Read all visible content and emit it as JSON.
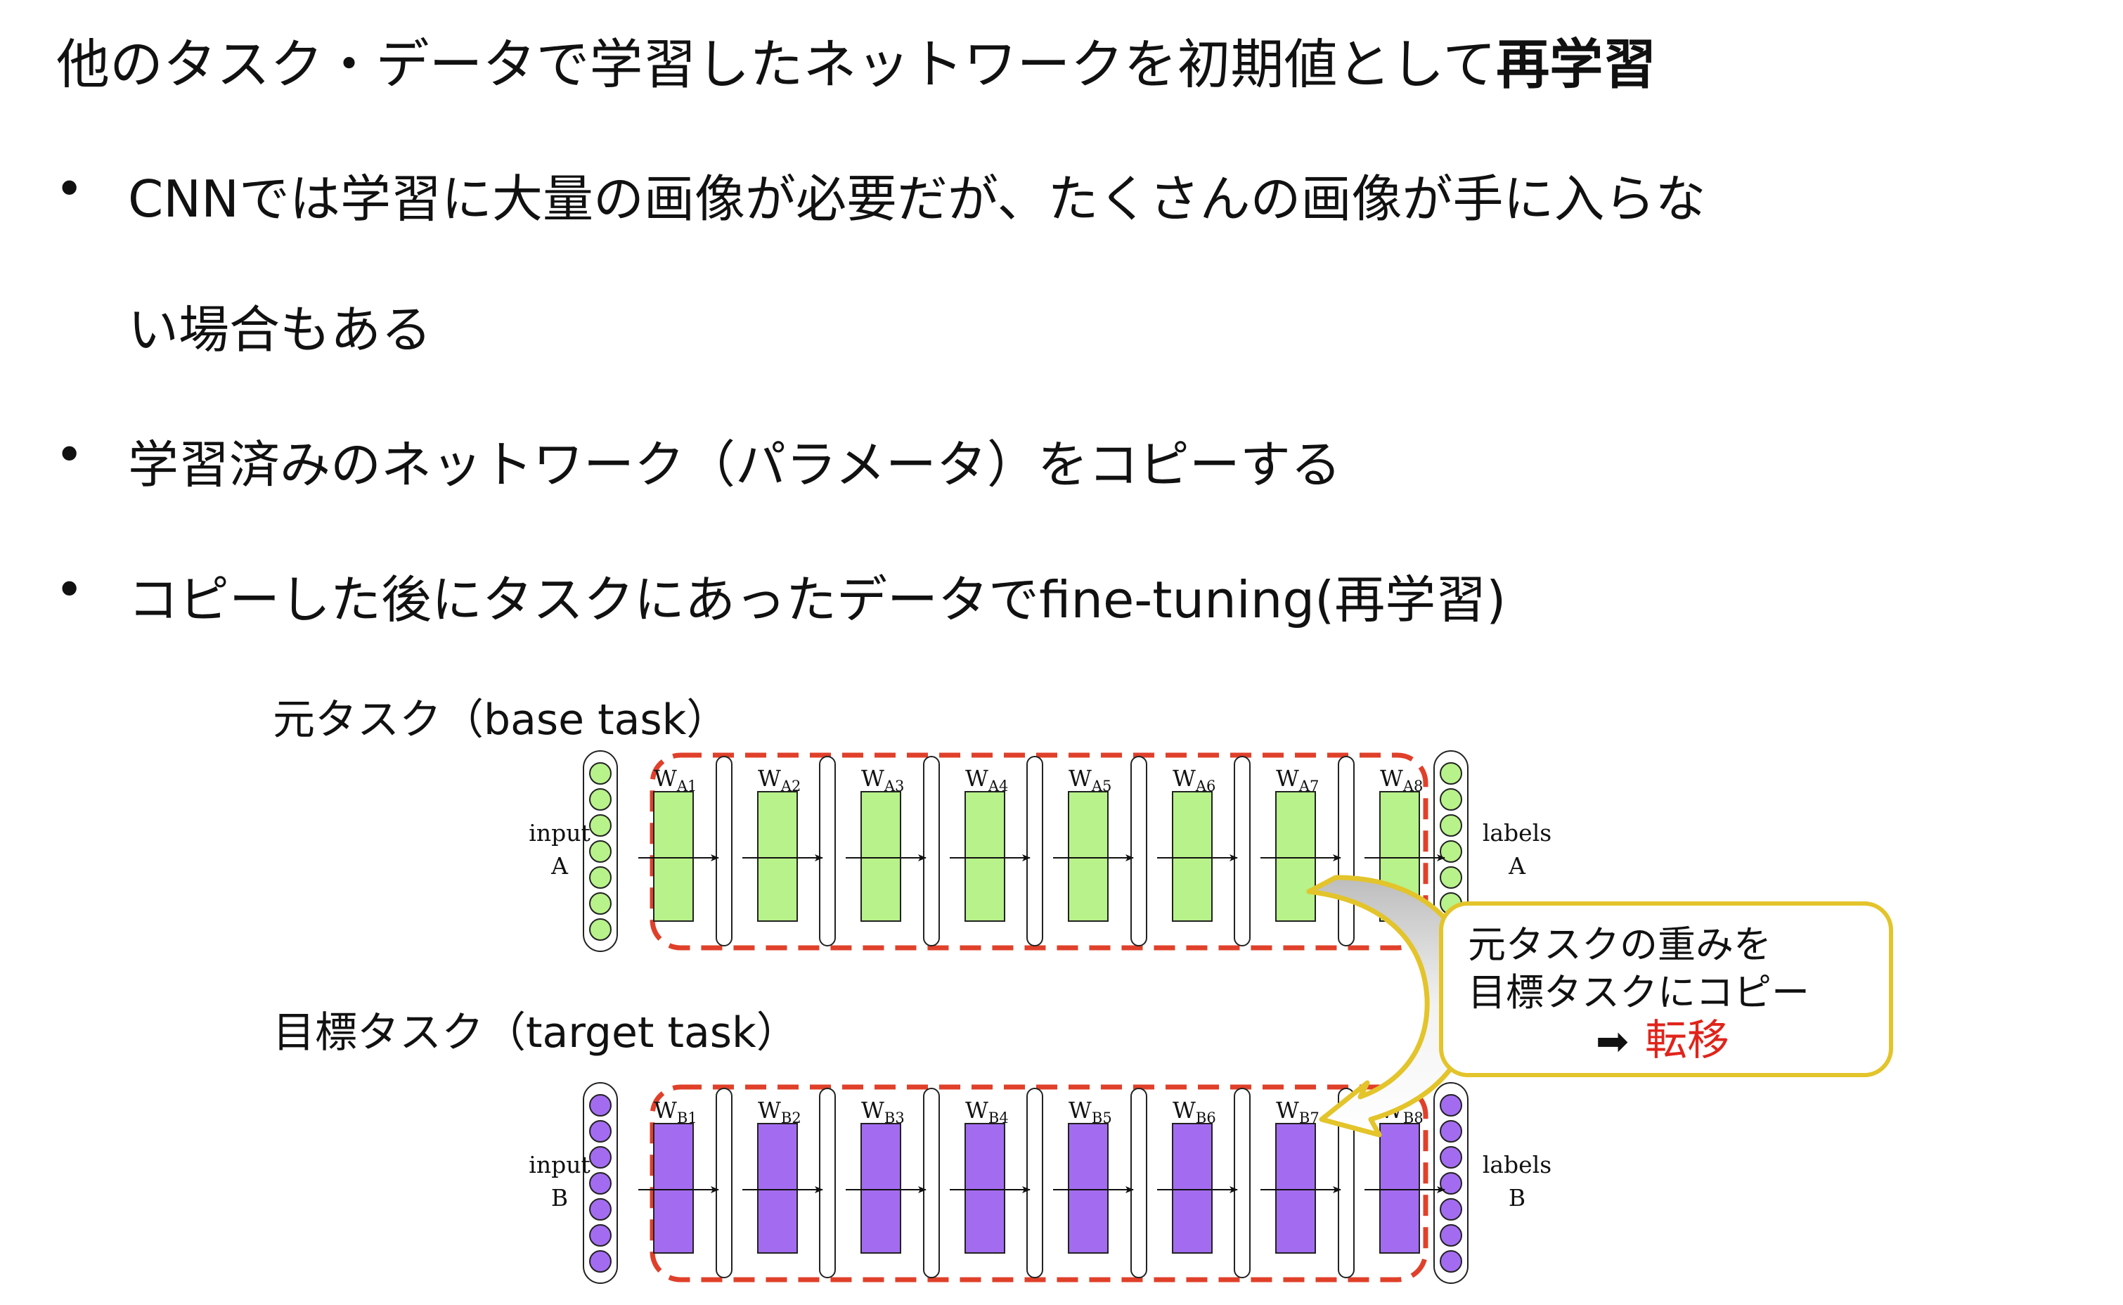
{
  "headline": {
    "text": "他のタスク・データで学習したネットワークを初期値として",
    "bold": "再学習"
  },
  "bullets": [
    {
      "lines": [
        "CNNでは学習に大量の画像が必要だが、たくさんの画像が手に入らな",
        "い場合もある"
      ]
    },
    {
      "lines": [
        "学習済みのネットワーク（パラメータ）をコピーする"
      ]
    },
    {
      "lines": [
        "コピーした後にタスクにあったデータでfine-tuning(再学習)"
      ]
    }
  ],
  "bullet_symbol": "•",
  "base_task": {
    "label": "元タスク（base task）",
    "input_lines": [
      "input",
      "A"
    ],
    "output_lines": [
      "labels",
      "A"
    ],
    "weights": [
      "A1",
      "A2",
      "A3",
      "A4",
      "A5",
      "A6",
      "A7",
      "A8"
    ],
    "color": "#b8f28a"
  },
  "target_task": {
    "label": "目標タスク（target task）",
    "input_lines": [
      "input",
      "B"
    ],
    "output_lines": [
      "labels",
      "B"
    ],
    "weights": [
      "B1",
      "B2",
      "B3",
      "B4",
      "B5",
      "B6",
      "B7",
      "B8"
    ],
    "color": "#a36cf0"
  },
  "weight_letter": "W",
  "callout": {
    "lines": [
      "元タスクの重みを",
      "目標タスクにコピー"
    ],
    "arrow_glyph": "➡",
    "result": "転移",
    "border_color": "#e3c42a",
    "result_color": "#e0241b"
  },
  "dash_color": "#e0402a"
}
